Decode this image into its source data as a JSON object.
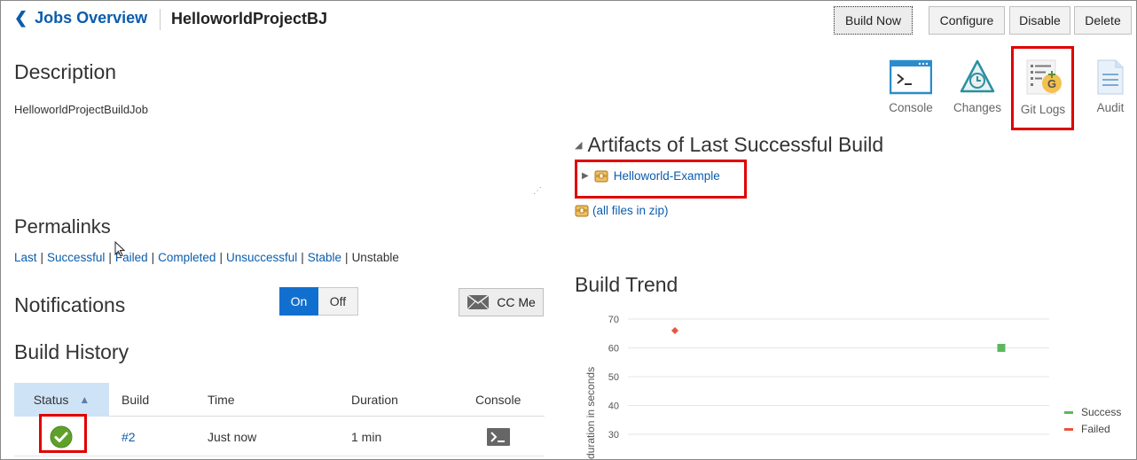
{
  "header": {
    "back_label": "Jobs Overview",
    "project_name": "HelloworldProjectBJ",
    "buttons": {
      "build_now": "Build Now",
      "configure": "Configure",
      "disable": "Disable",
      "delete": "Delete"
    }
  },
  "description": {
    "heading": "Description",
    "text": "HelloworldProjectBuildJob"
  },
  "permalinks": {
    "heading": "Permalinks",
    "links": [
      "Last",
      "Successful",
      "Failed",
      "Completed",
      "Unsuccessful",
      "Stable"
    ],
    "unstable": "Unstable"
  },
  "notifications": {
    "heading": "Notifications",
    "on": "On",
    "off": "Off",
    "cc_me": "CC Me"
  },
  "build_history": {
    "heading": "Build History",
    "columns": [
      "Status",
      "Build",
      "Time",
      "Duration",
      "Console"
    ],
    "rows": [
      {
        "status": "success",
        "build": "#2",
        "time": "Just now",
        "duration": "1 min"
      }
    ]
  },
  "tools": {
    "console": "Console",
    "changes": "Changes",
    "git_logs": "Git Logs",
    "audit": "Audit"
  },
  "artifacts": {
    "heading": "Artifacts of Last Successful Build",
    "item": "Helloworld-Example",
    "zip": "(all files in zip)"
  },
  "build_trend": {
    "heading": "Build Trend"
  },
  "colors": {
    "accent": "#1170cf",
    "link": "#0b5cad",
    "success": "#5cb85c",
    "failed": "#e8553e",
    "highlight": "#e00000"
  },
  "chart_data": {
    "type": "scatter",
    "ylabel": "duration in seconds",
    "yticks": [
      70,
      60,
      50,
      40,
      30
    ],
    "series": [
      {
        "name": "Success",
        "color": "#5cb85c",
        "marker": "square",
        "points": [
          {
            "x": 2,
            "y": 60
          }
        ]
      },
      {
        "name": "Failed",
        "color": "#e8553e",
        "marker": "diamond",
        "points": [
          {
            "x": 1,
            "y": 66
          }
        ]
      }
    ],
    "grid": true,
    "legend": "right"
  }
}
